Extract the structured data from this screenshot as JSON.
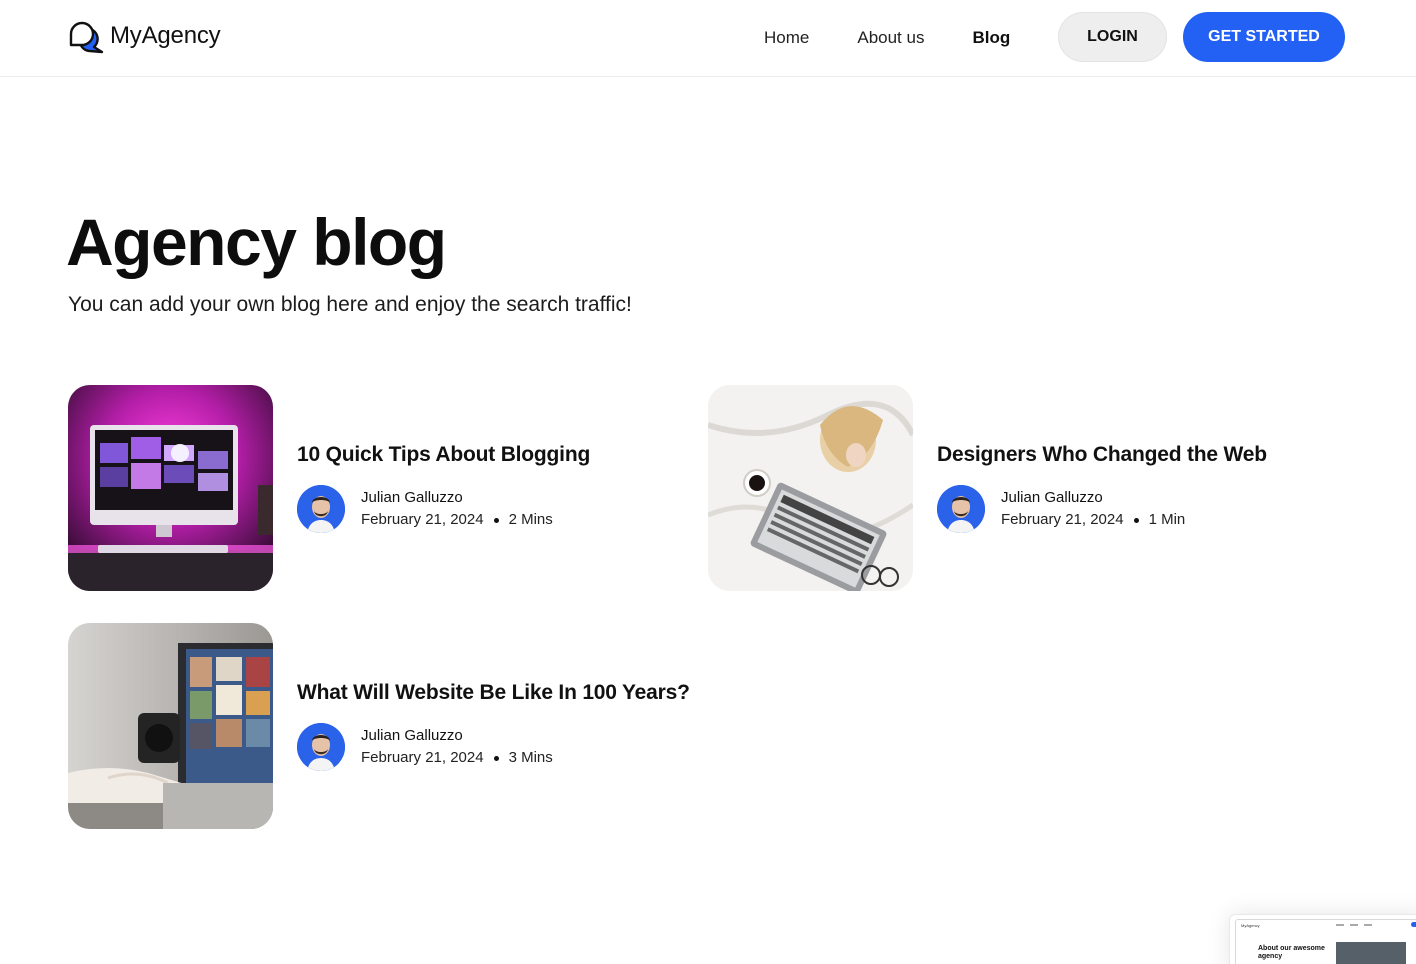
{
  "header": {
    "logo_text": "MyAgency",
    "nav": [
      {
        "label": "Home",
        "active": false
      },
      {
        "label": "About us",
        "active": false
      },
      {
        "label": "Blog",
        "active": true
      }
    ],
    "login_label": "LOGIN",
    "cta_label": "GET STARTED",
    "accent_color": "#2361f4"
  },
  "hero": {
    "title": "Agency blog",
    "subtitle": "You can add your own blog here and enjoy the search traffic!"
  },
  "posts": [
    {
      "title": "10 Quick Tips About Blogging",
      "author": "Julian Galluzzo",
      "date": "February 21, 2024",
      "read_time": "2 Mins",
      "image": "imac-pink-desk-image"
    },
    {
      "title": "Designers Who Changed the Web",
      "author": "Julian Galluzzo",
      "date": "February 21, 2024",
      "read_time": "1 Min",
      "image": "woman-bed-laptop-image"
    },
    {
      "title": "What Will Website Be Like In 100 Years?",
      "author": "Julian Galluzzo",
      "date": "February 21, 2024",
      "read_time": "3 Mins",
      "image": "laptop-typing-image"
    }
  ],
  "preview": {
    "logo_text": "MyAgency",
    "heading": "About our awesome agency"
  }
}
